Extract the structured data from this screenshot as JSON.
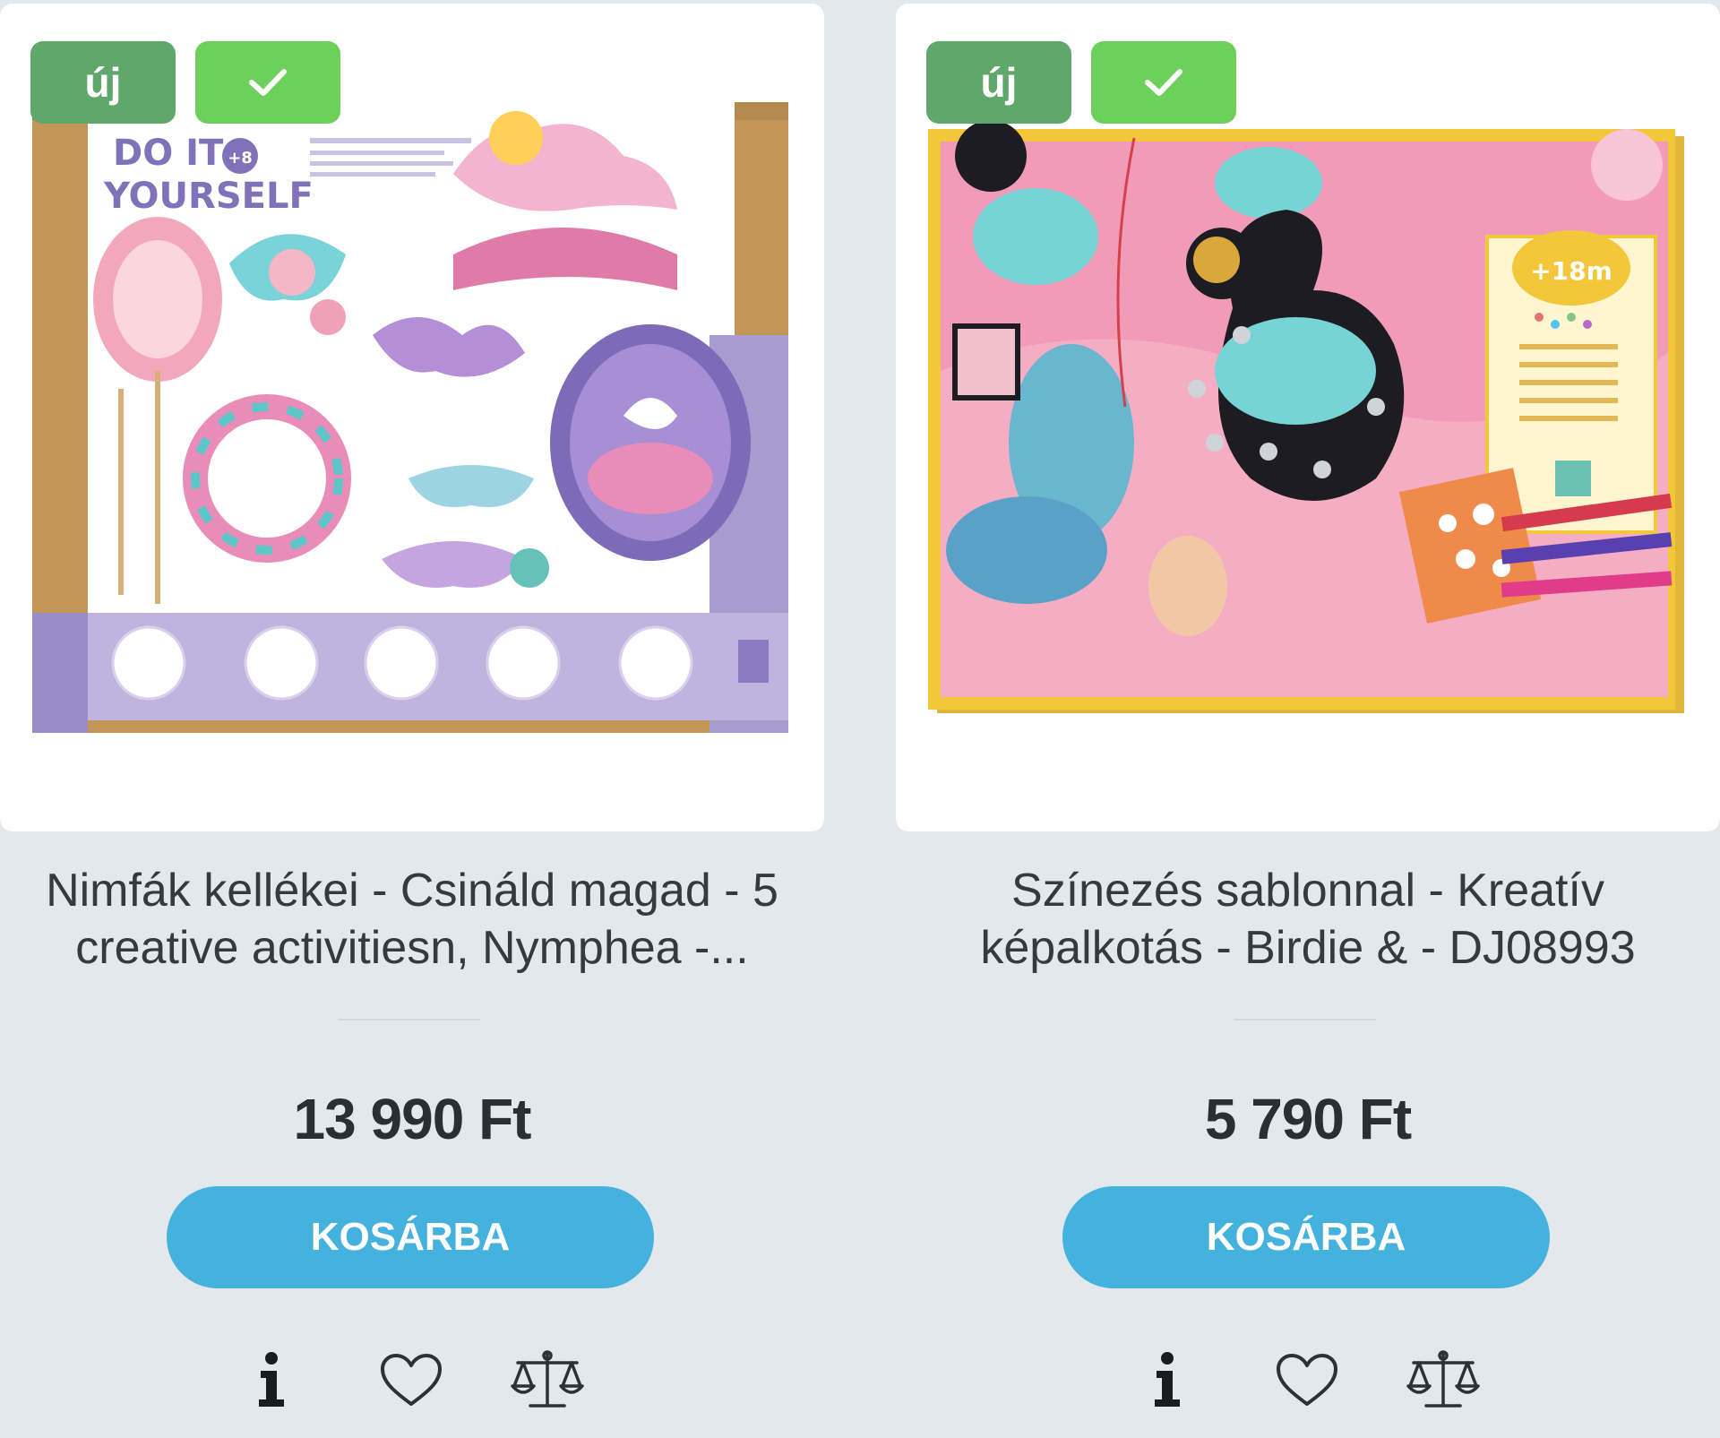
{
  "products": [
    {
      "badges": {
        "new": "új",
        "check_icon": "check-icon"
      },
      "title": "Nimfák kellékei - Csináld magad - 5 creative activitiesn, Nymphea -...",
      "price": "13 990 Ft",
      "cart_label": "KOSÁRBA",
      "image": {
        "brand_text_1": "DO IT",
        "brand_text_2": "YOURSELF",
        "age": "+8"
      },
      "actions": [
        "info-icon",
        "heart-icon",
        "compare-scale-icon"
      ]
    },
    {
      "badges": {
        "new": "új",
        "check_icon": "check-icon"
      },
      "title": "Színezés sablonnal - Kreatív képalkotás - Birdie & - DJ08993",
      "price": "5 790 Ft",
      "cart_label": "KOSÁRBA",
      "image": {
        "age": "+18m"
      },
      "actions": [
        "info-icon",
        "heart-icon",
        "compare-scale-icon"
      ]
    }
  ],
  "colors": {
    "page_bg": "#e2e8ec",
    "badge_new": "#5fa76a",
    "badge_check": "#6cd05a",
    "cart_button": "#45b1dd",
    "price_text": "#2a2f33"
  }
}
